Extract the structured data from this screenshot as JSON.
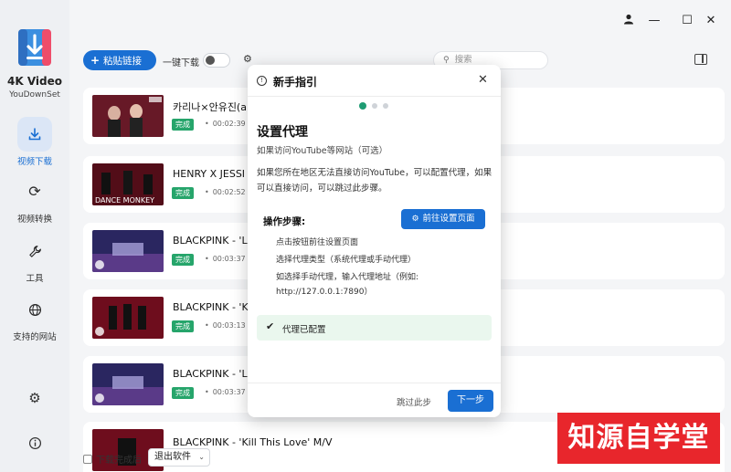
{
  "app": {
    "title": "4K Video",
    "subtitle": "YouDownSet"
  },
  "sidebar": {
    "items": [
      {
        "label": "视频下载",
        "icon": "download-icon",
        "active": true
      },
      {
        "label": "视频转换",
        "icon": "refresh-icon",
        "active": false
      },
      {
        "label": "工具",
        "icon": "wrench-icon",
        "active": false
      },
      {
        "label": "支持的网站",
        "icon": "globe-icon",
        "active": false
      }
    ],
    "bottom_icons": [
      "gear-icon",
      "info-icon"
    ]
  },
  "toolbar": {
    "paste_label": "粘贴链接",
    "one_click_label": "一键下载",
    "search_placeholder": "搜索"
  },
  "downloads": [
    {
      "title": "카리나×안유진(a",
      "status": "完成",
      "duration": "00:02:39"
    },
    {
      "title": "HENRY X JESSI - Lo",
      "status": "完成",
      "duration": "00:02:52"
    },
    {
      "title": "BLACKPINK - 'Lo",
      "status": "完成",
      "duration": "00:03:37"
    },
    {
      "title": "BLACKPINK - 'Ki",
      "status": "完成",
      "duration": "00:03:13"
    },
    {
      "title": "BLACKPINK - 'Lo",
      "status": "完成",
      "duration": "00:03:37"
    },
    {
      "title": "BLACKPINK - 'Kill This Love' M/V",
      "status": "",
      "duration": ""
    }
  ],
  "bottom_bar": {
    "after_done_label": "下载完成后",
    "exit_option": "退出软件"
  },
  "dialog": {
    "title": "新手指引",
    "step_count": 3,
    "current_step": 1,
    "step_title": "设置代理",
    "step_subtitle": "如果访问YouTube等网站（可选）",
    "description": "如果您所在地区无法直接访问YouTube，可以配置代理，如果可以直接访问，可以跳过此步骤。",
    "ops_label": "操作步骤:",
    "goto_settings_label": "前往设置页面",
    "steps": [
      "点击按钮前往设置页面",
      "选择代理类型（系统代理或手动代理）",
      "如选择手动代理，输入代理地址（例如: http://127.0.0.1:7890）"
    ],
    "status_text": "代理已配置",
    "skip_label": "跳过此步",
    "next_label": "下一步"
  },
  "watermark": "知源自学堂",
  "colors": {
    "accent": "#1a6fd3",
    "success": "#26a56b",
    "watermark": "#e8262c"
  }
}
